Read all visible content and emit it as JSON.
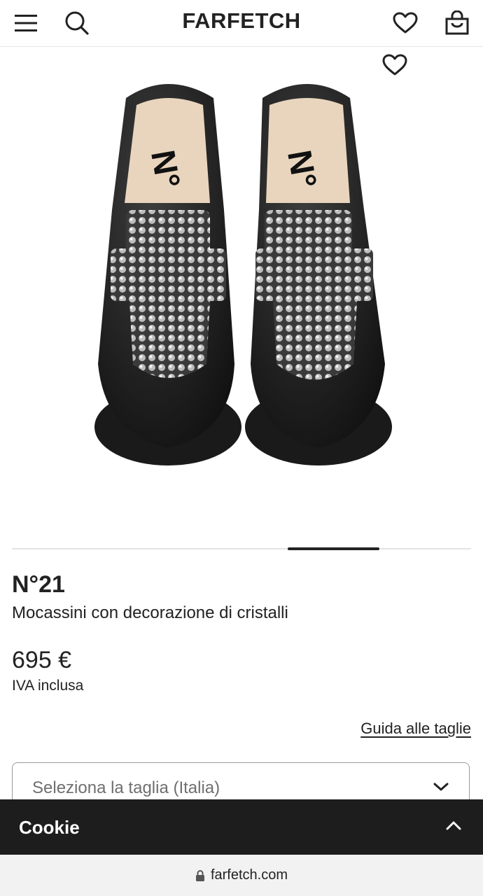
{
  "header": {
    "logo": "FARFETCH",
    "icons": [
      "menu-icon",
      "search-icon",
      "heart-icon",
      "bag-icon"
    ]
  },
  "gallery": {
    "current_slide_fraction": 0.2,
    "current_slide_position": 0.6
  },
  "product": {
    "brand": "N°21",
    "name": "Mocassini con decorazione di cristalli",
    "price": "695 €",
    "tax_note": "IVA inclusa",
    "size_guide_link": "Guida alle taglie",
    "size_select_placeholder": "Seleziona la taglia (Italia)"
  },
  "cookie_bar": {
    "label": "Cookie"
  },
  "browser": {
    "url": "farfetch.com"
  },
  "colors": {
    "text": "#222222",
    "cookie_bg": "#1d1d1d"
  }
}
